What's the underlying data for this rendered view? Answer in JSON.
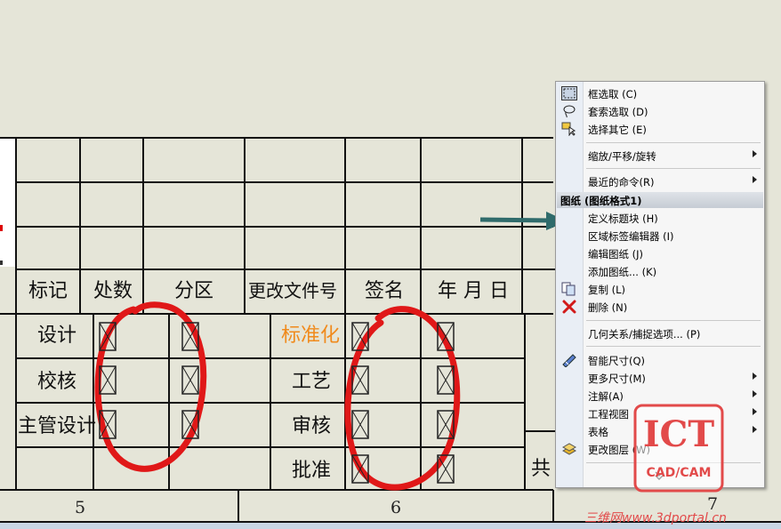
{
  "table": {
    "header": [
      "标记",
      "处数",
      "分区",
      "更改文件号",
      "签名",
      "年 月 日"
    ],
    "left_labels": [
      "设计",
      "校核",
      "主管设计"
    ],
    "middle_labels": [
      "标准化",
      "工艺",
      "审核",
      "批准"
    ],
    "right_partial": "共",
    "zones": [
      "5",
      "6",
      "7"
    ]
  },
  "context_menu": {
    "items": [
      {
        "label": "框选取 (C)",
        "icon": "box-select-icon"
      },
      {
        "label": "套索选取 (D)",
        "icon": "lasso-select-icon"
      },
      {
        "label": "选择其它 (E)",
        "icon": "select-other-icon"
      },
      {
        "label": "缩放/平移/旋转",
        "submenu": true
      },
      {
        "label": "最近的命令(R)",
        "submenu": true
      },
      {
        "label": "图纸 (图纸格式1)",
        "header": true
      },
      {
        "label": "定义标题块 (H)"
      },
      {
        "label": "区域标签编辑器 (I)"
      },
      {
        "label": "编辑图纸 (J)"
      },
      {
        "label": "添加图纸... (K)"
      },
      {
        "label": "复制 (L)",
        "icon": "copy-icon"
      },
      {
        "label": "删除 (N)",
        "icon": "delete-icon"
      },
      {
        "label": "几何关系/捕捉选项... (P)"
      },
      {
        "label": "智能尺寸(Q)",
        "icon": "smart-dimension-icon"
      },
      {
        "label": "更多尺寸(M)",
        "submenu": true
      },
      {
        "label": "注解(A)",
        "submenu": true
      },
      {
        "label": "工程视图",
        "submenu": true
      },
      {
        "label": "表格",
        "submenu": true
      },
      {
        "label": "更改图层 (W)",
        "icon": "change-layer-icon"
      }
    ]
  },
  "watermark": {
    "logo": "ICT",
    "sub": "CAD/CAM"
  },
  "site_watermark": "三维网www.3dportal.cn",
  "colors": {
    "annotation_red": "#e01818",
    "arrow": "#2f6b6b",
    "highlight_orange": "#f08a1c"
  }
}
